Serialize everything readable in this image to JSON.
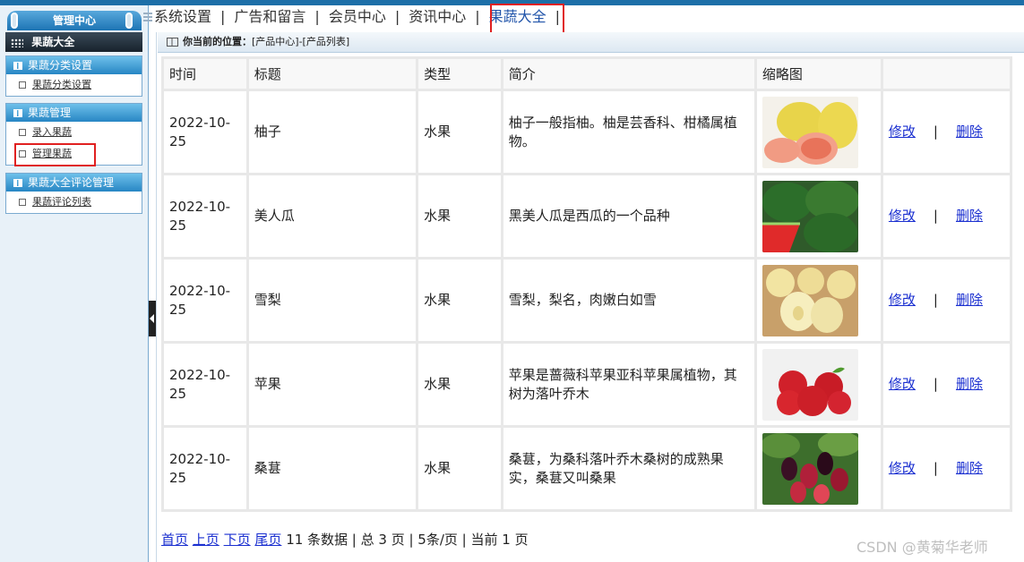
{
  "sidebar": {
    "header": "管理中心",
    "section_title": "果蔬大全",
    "groups": [
      {
        "title": "果蔬分类设置",
        "items": [
          "果蔬分类设置"
        ]
      },
      {
        "title": "果蔬管理",
        "items": [
          "录入果蔬",
          "管理果蔬"
        ]
      },
      {
        "title": "果蔬大全评论管理",
        "items": [
          "果蔬评论列表"
        ]
      }
    ]
  },
  "nav": {
    "items": [
      "系统设置",
      "广告和留言",
      "会员中心",
      "资讯中心",
      "果蔬大全"
    ],
    "separator": "|",
    "active_index": 4
  },
  "breadcrumb": {
    "label": "你当前的位置：",
    "path": "[产品中心]-[产品列表]"
  },
  "table": {
    "headers": [
      "时间",
      "标题",
      "类型",
      "简介",
      "缩略图",
      ""
    ],
    "edit_label": "修改",
    "delete_label": "删除",
    "separator": "|",
    "rows": [
      {
        "time": "2022-10-25",
        "title": "柚子",
        "type": "水果",
        "intro": "柚子一般指柚。柚是芸香科、柑橘属植物。",
        "thumb": "pomelo"
      },
      {
        "time": "2022-10-25",
        "title": "美人瓜",
        "type": "水果",
        "intro": "黑美人瓜是西瓜的一个品种",
        "thumb": "watermelon"
      },
      {
        "time": "2022-10-25",
        "title": "雪梨",
        "type": "水果",
        "intro": "雪梨，梨名，肉嫩白如雪",
        "thumb": "pear"
      },
      {
        "time": "2022-10-25",
        "title": "苹果",
        "type": "水果",
        "intro": "苹果是蔷薇科苹果亚科苹果属植物，其树为落叶乔木",
        "thumb": "apple"
      },
      {
        "time": "2022-10-25",
        "title": "桑葚",
        "type": "水果",
        "intro": "桑葚，为桑科落叶乔木桑树的成熟果实，桑葚又叫桑果",
        "thumb": "mulberry"
      }
    ]
  },
  "pager": {
    "first": "首页",
    "prev": "上页",
    "next": "下页",
    "last": "尾页",
    "summary": "11 条数据 | 总 3 页 | 5条/页 | 当前 1 页"
  },
  "watermark": "CSDN @黄菊华老师",
  "colors": {
    "accent": "#1d74b4",
    "link": "#1a2fd0",
    "highlight": "#e02020"
  }
}
